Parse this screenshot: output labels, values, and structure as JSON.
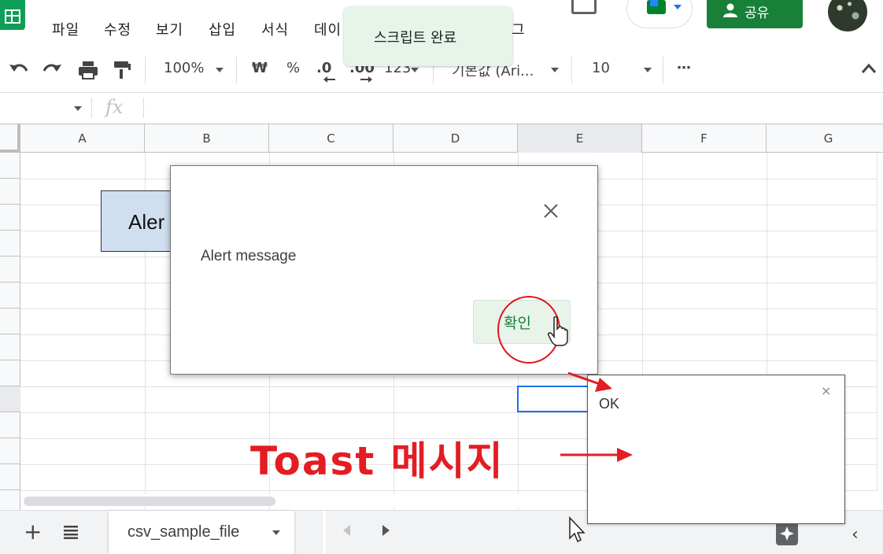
{
  "menu": {
    "items": [
      "파일",
      "수정",
      "보기",
      "삽입",
      "서식",
      "데이",
      "그"
    ]
  },
  "top_toast": {
    "text": "스크립트 완료"
  },
  "share_label": "공유",
  "toolbar": {
    "zoom": "100%",
    "currency": "₩",
    "percent": "%",
    "dec_decrease": ".0",
    "dec_increase": ".00",
    "format_more": "123",
    "font": "기본값 (Ari...",
    "font_size": "10",
    "more": "⋯",
    "collapse": "^"
  },
  "formula_bar": {
    "fx": "fx"
  },
  "columns": [
    "A",
    "B",
    "C",
    "D",
    "E",
    "F",
    "G"
  ],
  "selected_column": "E",
  "alert_button_shape": {
    "label": "Aler"
  },
  "dialog": {
    "message": "Alert message",
    "ok_label": "확인",
    "close_glyph": "×"
  },
  "side_toast": {
    "text": "OK",
    "close_glyph": "×"
  },
  "annotation": {
    "text": "Toast 메시지"
  },
  "sheetbar": {
    "add": "+",
    "sheet_name": "csv_sample_file",
    "collapse": "‹"
  },
  "colors": {
    "accent_green": "#188038",
    "sheets_green": "#0f9d58",
    "selection_blue": "#1a73e8",
    "annotation_red": "#e41c23",
    "toast_bg": "#e6f4ea"
  }
}
